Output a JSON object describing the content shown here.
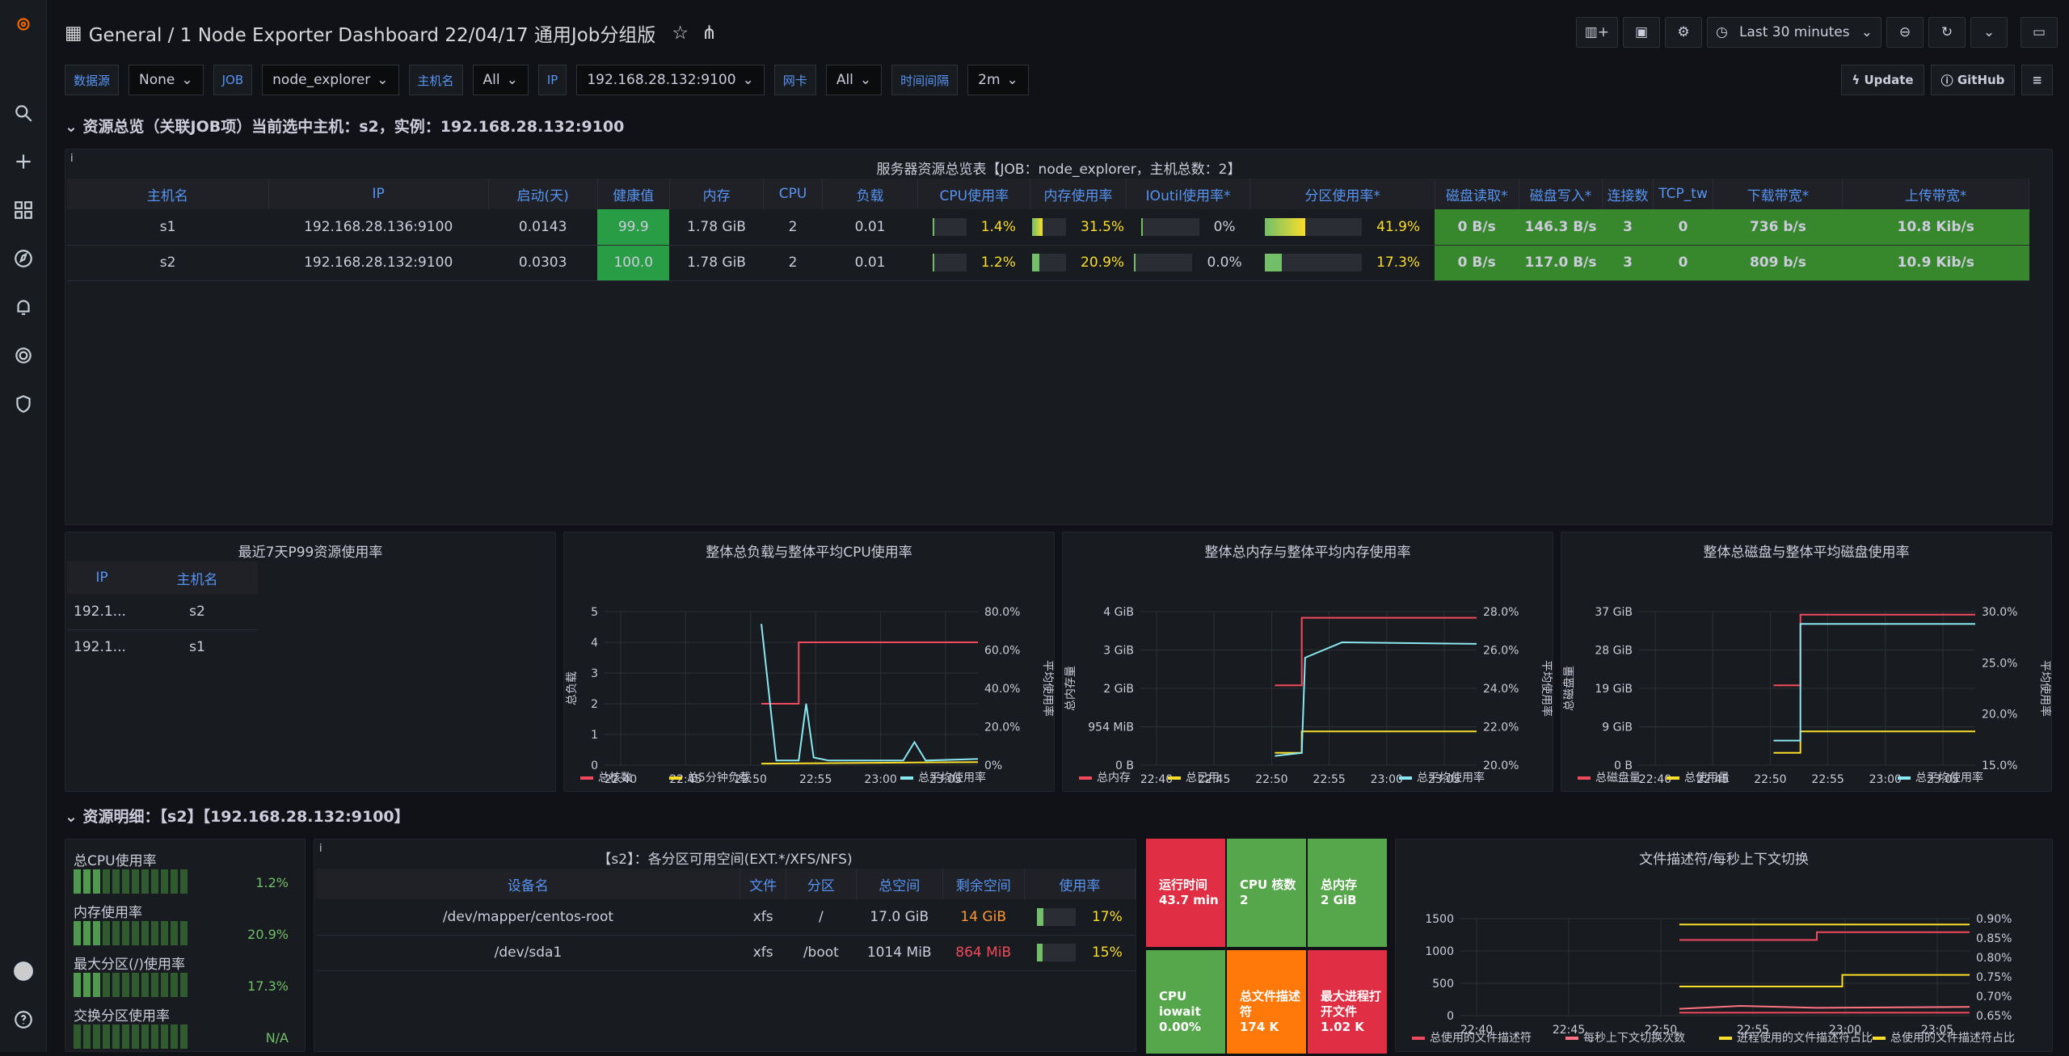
{
  "nav": {
    "breadcrumb": "General / 1 Node Exporter Dashboard 22/04/17 通用Job分组版",
    "time_range": "Last 30 minutes"
  },
  "vars": [
    {
      "label": "数据源",
      "value": "None"
    },
    {
      "label": "JOB",
      "value": "node_explorer"
    },
    {
      "label": "主机名",
      "value": "All"
    },
    {
      "label": "IP",
      "value": "192.168.28.132:9100"
    },
    {
      "label": "网卡",
      "value": "All"
    },
    {
      "label": "时间间隔",
      "value": "2m"
    }
  ],
  "links": {
    "update": "Update",
    "github": "GitHub"
  },
  "row1": "资源总览（关联JOB项）当前选中主机：s2，实例：192.168.28.132:9100",
  "row2": "资源明细：【s2】【192.168.28.132:9100】",
  "summary": {
    "title": "服务器资源总览表【JOB：node_explorer，主机总数：2】",
    "headers": [
      "主机名",
      "IP",
      "启动(天)",
      "健康值",
      "内存",
      "CPU",
      "负载",
      "CPU使用率",
      "内存使用率",
      "IOutil使用率*",
      "分区使用率*",
      "磁盘读取*",
      "磁盘写入*",
      "连接数",
      "TCP_tw",
      "下载带宽*",
      "上传带宽*"
    ],
    "rows": [
      [
        "s1",
        "192.168.28.136:9100",
        "0.0143",
        "99.9",
        "1.78 GiB",
        "2",
        "0.01",
        "1.4%",
        "31.5%",
        "0%",
        "41.9%",
        "0 B/s",
        "146.3 B/s",
        "3",
        "0",
        "736 b/s",
        "10.8 Kib/s"
      ],
      [
        "s2",
        "192.168.28.132:9100",
        "0.0303",
        "100.0",
        "1.78 GiB",
        "2",
        "0.01",
        "1.2%",
        "20.9%",
        "0.0%",
        "17.3%",
        "0 B/s",
        "117.0 B/s",
        "3",
        "0",
        "809 b/s",
        "10.9 Kib/s"
      ]
    ],
    "bars": [
      [
        0.014,
        0.315,
        0,
        0.419
      ],
      [
        0.012,
        0.209,
        0,
        0.173
      ]
    ]
  },
  "p99": {
    "title": "最近7天P99资源使用率",
    "headers": [
      "IP",
      "主机名"
    ],
    "rows": [
      [
        "192.1...",
        "s2"
      ],
      [
        "192.1...",
        "s1"
      ]
    ]
  },
  "cpu_chart": {
    "title": "整体总负载与整体平均CPU使用率",
    "yl": [
      "5",
      "4",
      "3",
      "2",
      "1",
      "0"
    ],
    "yr": [
      "80.0%",
      "60.0%",
      "40.0%",
      "20.0%",
      "0%"
    ],
    "x": [
      "22:40",
      "22:45",
      "22:50",
      "22:55",
      "23:00",
      "23:05"
    ],
    "ylabel": "总负载",
    "y2label": "平均使用率",
    "legend": [
      "总核数",
      "总5分钟负载",
      "总平均使用率"
    ]
  },
  "mem_chart": {
    "title": "整体总内存与整体平均内存使用率",
    "yl": [
      "4 GiB",
      "3 GiB",
      "2 GiB",
      "954 MiB",
      "0 B"
    ],
    "yr": [
      "28.0%",
      "26.0%",
      "24.0%",
      "22.0%",
      "20.0%"
    ],
    "x": [
      "22:40",
      "22:45",
      "22:50",
      "22:55",
      "23:00",
      "23:05"
    ],
    "ylabel": "总内存量",
    "y2label": "平均使用率",
    "legend": [
      "总内存",
      "总已用",
      "总平均使用率"
    ]
  },
  "disk_chart": {
    "title": "整体总磁盘与整体平均磁盘使用率",
    "yl": [
      "37 GiB",
      "28 GiB",
      "19 GiB",
      "9 GiB",
      "0 B"
    ],
    "yr": [
      "30.0%",
      "25.0%",
      "20.0%",
      "15.0%"
    ],
    "x": [
      "22:40",
      "22:45",
      "22:50",
      "22:55",
      "23:00",
      "23:05"
    ],
    "ylabel": "总磁盘量",
    "y2label": "平均使用率",
    "legend": [
      "总磁盘量",
      "总使用量",
      "总平均使用率"
    ]
  },
  "gauges": [
    {
      "label": "总CPU使用率",
      "value": "1.2%"
    },
    {
      "label": "内存使用率",
      "value": "20.9%"
    },
    {
      "label": "最大分区(/)使用率",
      "value": "17.3%"
    },
    {
      "label": "交换分区使用率",
      "value": "N/A"
    }
  ],
  "fs": {
    "title": "【s2】：各分区可用空间(EXT.*/XFS/NFS)",
    "headers": [
      "设备名",
      "文件",
      "分区",
      "总空间",
      "剩余空间",
      "使用率"
    ],
    "rows": [
      [
        "/dev/mapper/centos-root",
        "xfs",
        "/",
        "17.0 GiB",
        "14 GiB",
        "17%"
      ],
      [
        "/dev/sda1",
        "xfs",
        "/boot",
        "1014 MiB",
        "864 MiB",
        "15%"
      ]
    ]
  },
  "stats": [
    {
      "l": "运行时间",
      "v": "43.7 min",
      "c": "#e02f44"
    },
    {
      "l": "CPU 核数",
      "v": "2",
      "c": "#56a64b"
    },
    {
      "l": "总内存",
      "v": "2 GiB",
      "c": "#56a64b"
    },
    {
      "l": "CPU iowait",
      "v": "0.00%",
      "c": "#56a64b"
    },
    {
      "l": "总文件描述符",
      "v": "174 K",
      "c": "#ff780a"
    },
    {
      "l": "最大进程打开文件",
      "v": "1.02 K",
      "c": "#e02f44"
    }
  ],
  "fd_chart": {
    "title": "文件描述符/每秒上下文切换",
    "yl": [
      "1500",
      "1000",
      "500",
      "0"
    ],
    "yr": [
      "0.90%",
      "0.85%",
      "0.80%",
      "0.75%",
      "0.70%",
      "0.65%"
    ],
    "x": [
      "22:40",
      "22:45",
      "22:50",
      "22:55",
      "23:00",
      "23:05"
    ],
    "legend": [
      "总使用的文件描述符",
      "每秒上下文切换次数",
      "进程使用的文件描述符占比",
      "总使用的文件描述符占比"
    ]
  }
}
